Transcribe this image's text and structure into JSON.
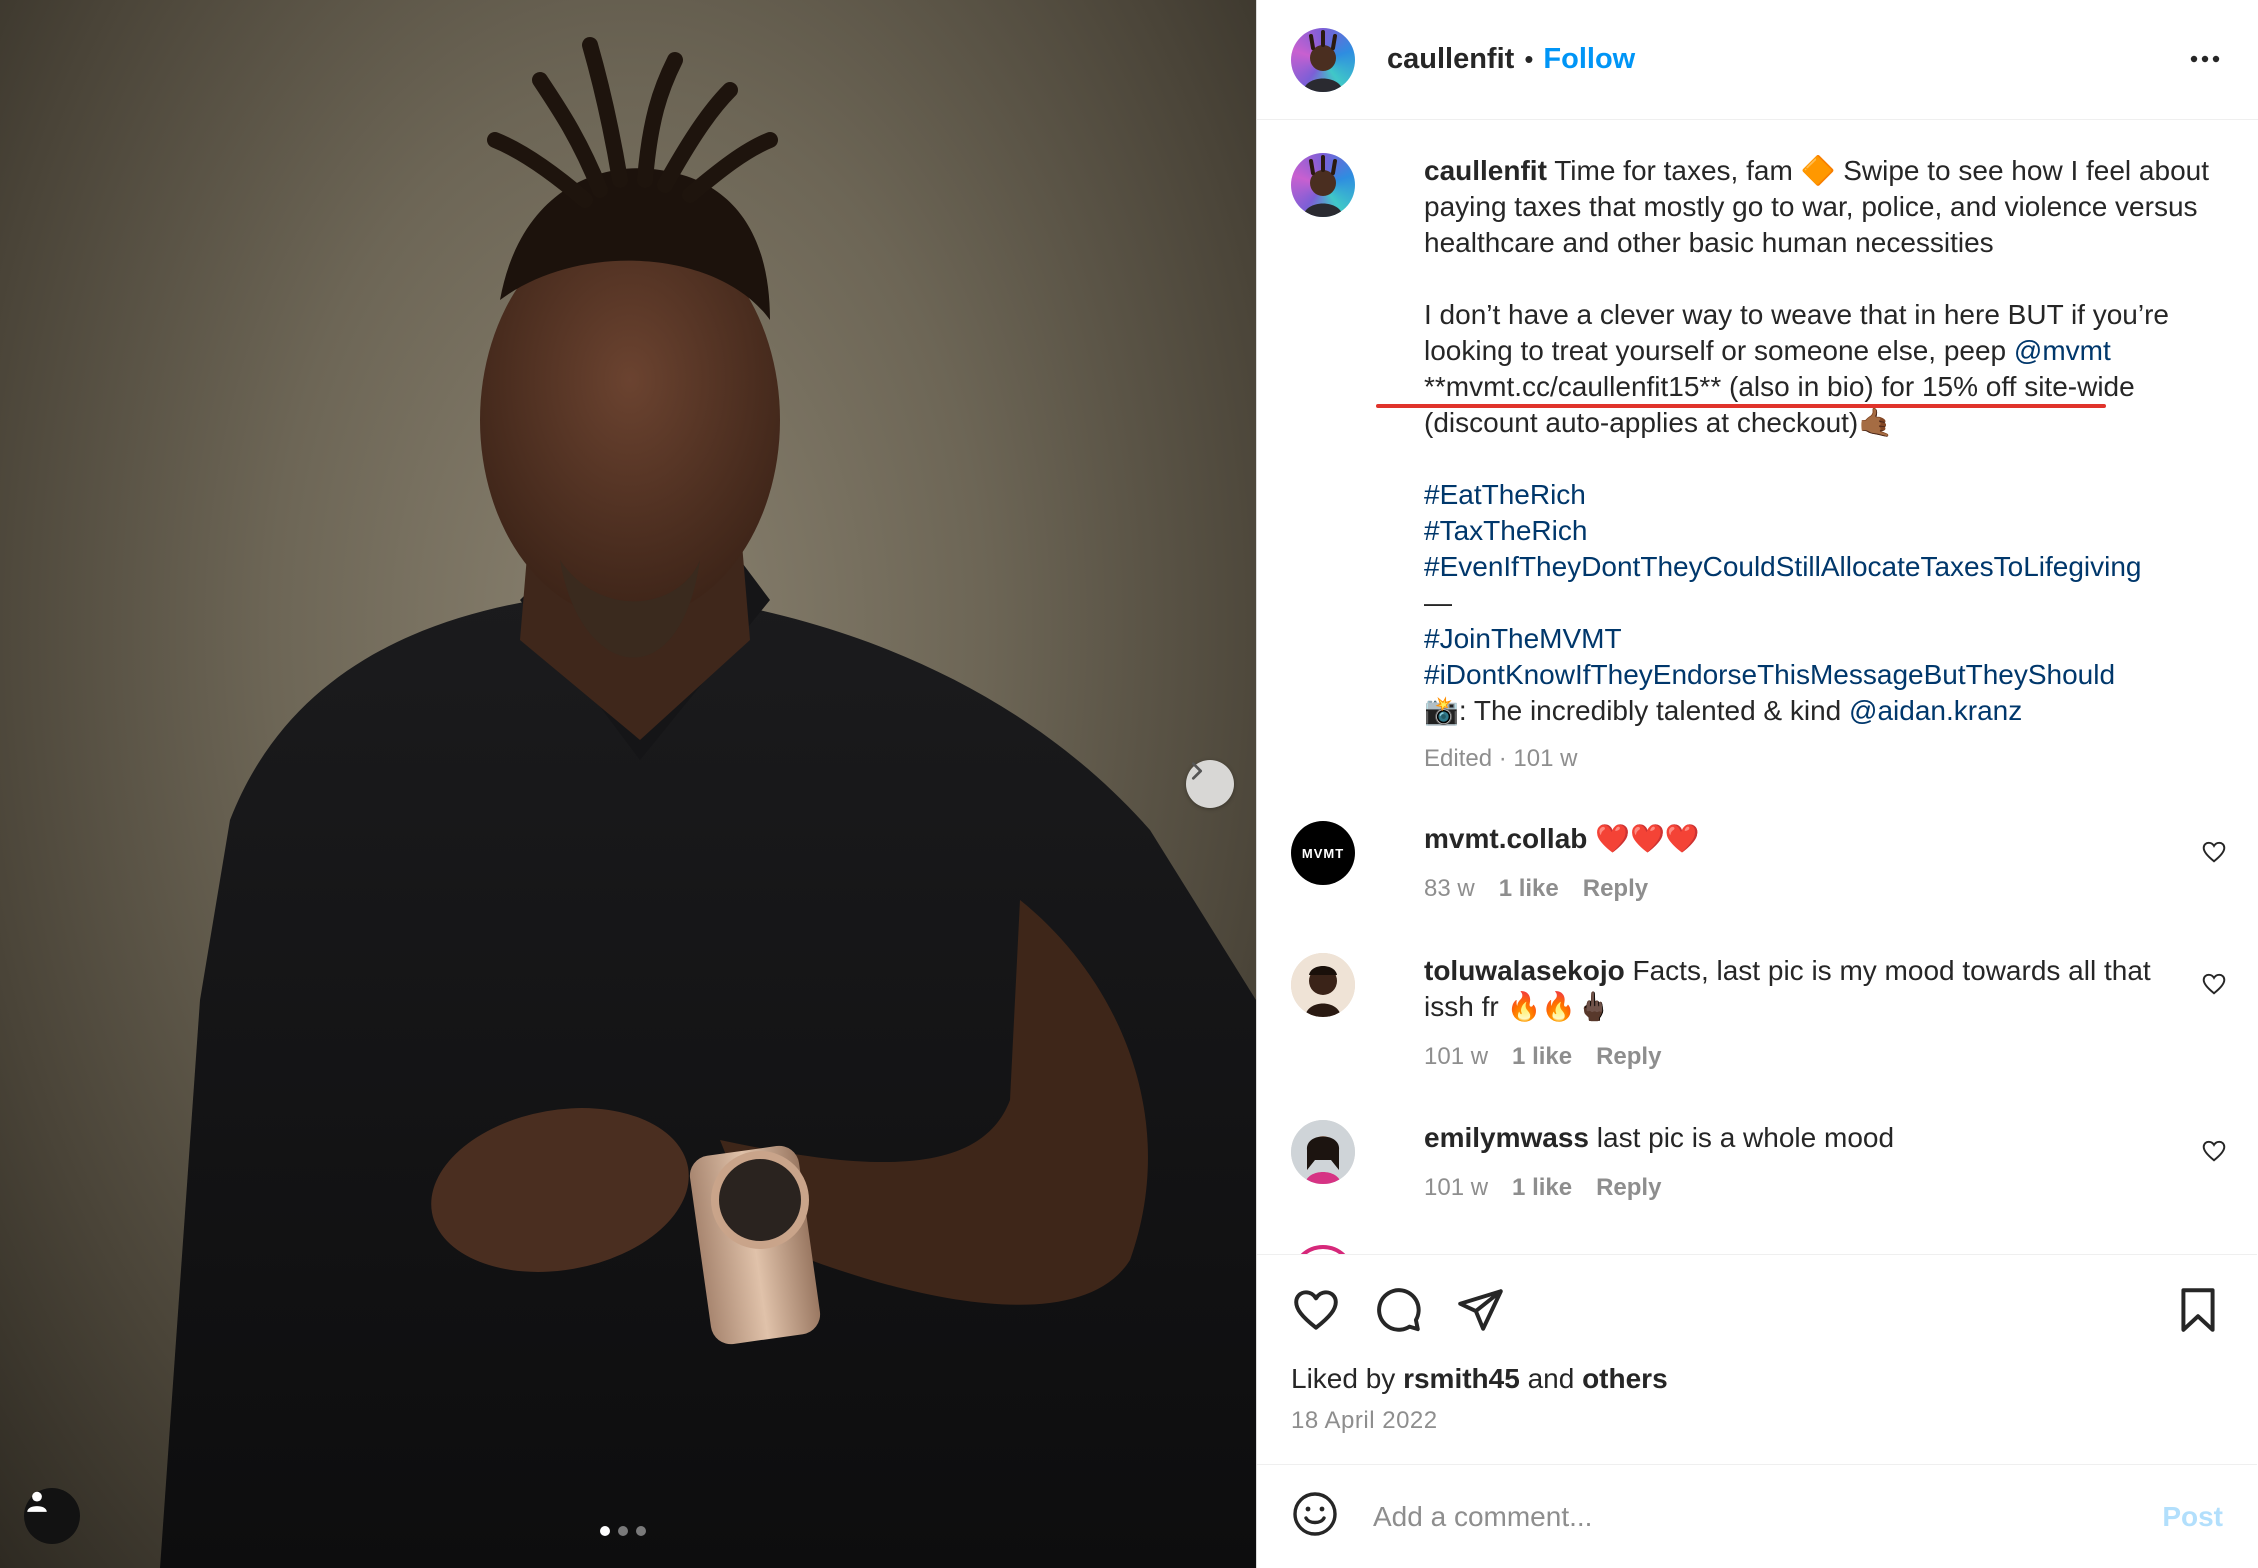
{
  "post": {
    "username": "caullenfit",
    "separator": "•",
    "follow_label": "Follow",
    "more_icon": "more-horizontal-icon"
  },
  "caption": {
    "username": "caullenfit",
    "line1": "Time for taxes, fam 🔶 Swipe to see how I feel about",
    "line2": "paying taxes that mostly go to war, police, and violence versus",
    "line3": "healthcare and other basic human necessities",
    "line4": "I don’t have a clever way to weave that in here BUT if you’re",
    "line5_text": "looking to treat yourself or someone else, peep ",
    "line5_mention": "@mvmt",
    "line6": "**mvmt.cc/caullenfit15** (also in bio) for 15% off site-wide",
    "line7": "(discount auto-applies at checkout)🤙🏾",
    "hashtags": [
      "#EatTheRich",
      "#TaxTheRich",
      "#EvenIfTheyDontTheyCouldStillAllocateTaxesToLifegiving"
    ],
    "dash": "—",
    "hashtags2": [
      "#JoinTheMVMT",
      "#iDontKnowIfTheyEndorseThisMessageButTheyShould"
    ],
    "credit_prefix": "📸: The incredibly talented & kind ",
    "credit_mention": "@aidan.kranz",
    "meta": "Edited · 101 w"
  },
  "comments": [
    {
      "username": "mvmt.collab",
      "text": "❤️❤️❤️",
      "time": "83 w",
      "likes": "1 like",
      "reply": "Reply",
      "avatar_text": "MVMT"
    },
    {
      "username": "toluwalasekojo",
      "text": "Facts, last pic is my mood towards all that",
      "text2": "issh fr 🔥🔥🖕🏿",
      "time": "101 w",
      "likes": "1 like",
      "reply": "Reply"
    },
    {
      "username": "emilymwass",
      "text": "last pic is a whole mood",
      "time": "101 w",
      "likes": "1 like",
      "reply": "Reply"
    }
  ],
  "actions": {
    "liked_prefix": "Liked by ",
    "liked_user": "rsmith45",
    "liked_mid": " and ",
    "liked_others": "others",
    "date": "18 April 2022"
  },
  "comment_box": {
    "placeholder": "Add a comment...",
    "post_label": "Post"
  },
  "carousel": {
    "total": 3,
    "active": 1
  },
  "colors": {
    "link": "#00376b",
    "follow": "#0095f6",
    "underline": "#e0332b",
    "post_disabled": "#b2dffc"
  }
}
